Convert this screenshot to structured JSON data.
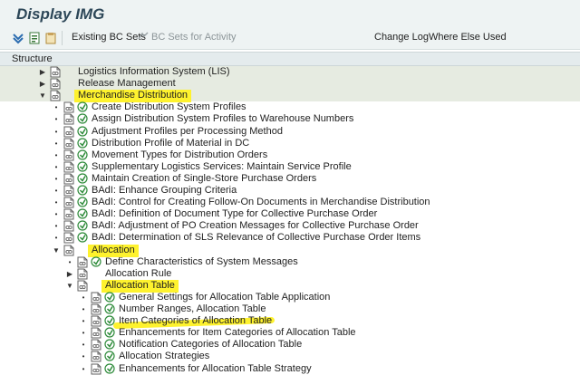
{
  "title": "Display IMG",
  "toolbar": {
    "existing_bc_sets": "Existing BC Sets",
    "bc_sets_activity": "BC Sets for Activity",
    "change_log": "Change Log",
    "where_else_used": "Where Else Used"
  },
  "structure_label": "Structure",
  "tree": [
    {
      "label": "Logistics Information System (LIS)",
      "level": 0,
      "kind": "folder",
      "expander": "closed"
    },
    {
      "label": "Release Management",
      "level": 0,
      "kind": "folder",
      "expander": "closed"
    },
    {
      "label": "Merchandise Distribution",
      "level": 0,
      "kind": "folder",
      "expander": "open",
      "highlight": "marker"
    },
    {
      "label": "Create Distribution System Profiles",
      "level": 1,
      "kind": "activity"
    },
    {
      "label": "Assign Distribution System Profiles to Warehouse Numbers",
      "level": 1,
      "kind": "activity"
    },
    {
      "label": "Adjustment Profiles per Processing Method",
      "level": 1,
      "kind": "activity"
    },
    {
      "label": "Distribution Profile of Material in DC",
      "level": 1,
      "kind": "activity"
    },
    {
      "label": "Movement Types for Distribution Orders",
      "level": 1,
      "kind": "activity"
    },
    {
      "label": "Supplementary Logistics Services: Maintain Service Profile",
      "level": 1,
      "kind": "activity"
    },
    {
      "label": "Maintain Creation of Single-Store Purchase Orders",
      "level": 1,
      "kind": "activity"
    },
    {
      "label": "BAdI: Enhance Grouping Criteria",
      "level": 1,
      "kind": "activity"
    },
    {
      "label": "BAdI: Control for Creating Follow-On Documents in Merchandise Distribution",
      "level": 1,
      "kind": "activity"
    },
    {
      "label": "BAdI: Definition of Document Type for Collective Purchase Order",
      "level": 1,
      "kind": "activity"
    },
    {
      "label": "BAdI: Adjustment of PO Creation Messages for Collective Purchase Order",
      "level": 1,
      "kind": "activity"
    },
    {
      "label": "BAdI: Determination of SLS Relevance of Collective Purchase Order Items",
      "level": 1,
      "kind": "activity"
    },
    {
      "label": "Allocation",
      "level": 1,
      "kind": "folder",
      "expander": "open",
      "highlight": "marker"
    },
    {
      "label": "Define Characteristics of System Messages",
      "level": 2,
      "kind": "activity"
    },
    {
      "label": "Allocation Rule",
      "level": 2,
      "kind": "folder",
      "expander": "closed"
    },
    {
      "label": "Allocation Table",
      "level": 2,
      "kind": "folder",
      "expander": "open",
      "highlight": "marker"
    },
    {
      "label": "General Settings for Allocation Table Application",
      "level": 3,
      "kind": "activity"
    },
    {
      "label": "Number Ranges, Allocation Table",
      "level": 3,
      "kind": "activity"
    },
    {
      "label": "Item Categories of Allocation Table",
      "level": 3,
      "kind": "activity",
      "highlight": "stroke"
    },
    {
      "label": "Enhancements for Item Categories of Allocation Table",
      "level": 3,
      "kind": "activity"
    },
    {
      "label": "Notification Categories of Allocation Table",
      "level": 3,
      "kind": "activity"
    },
    {
      "label": "Allocation Strategies",
      "level": 3,
      "kind": "activity"
    },
    {
      "label": "Enhancements for Allocation Table Strategy",
      "level": 3,
      "kind": "activity"
    }
  ]
}
